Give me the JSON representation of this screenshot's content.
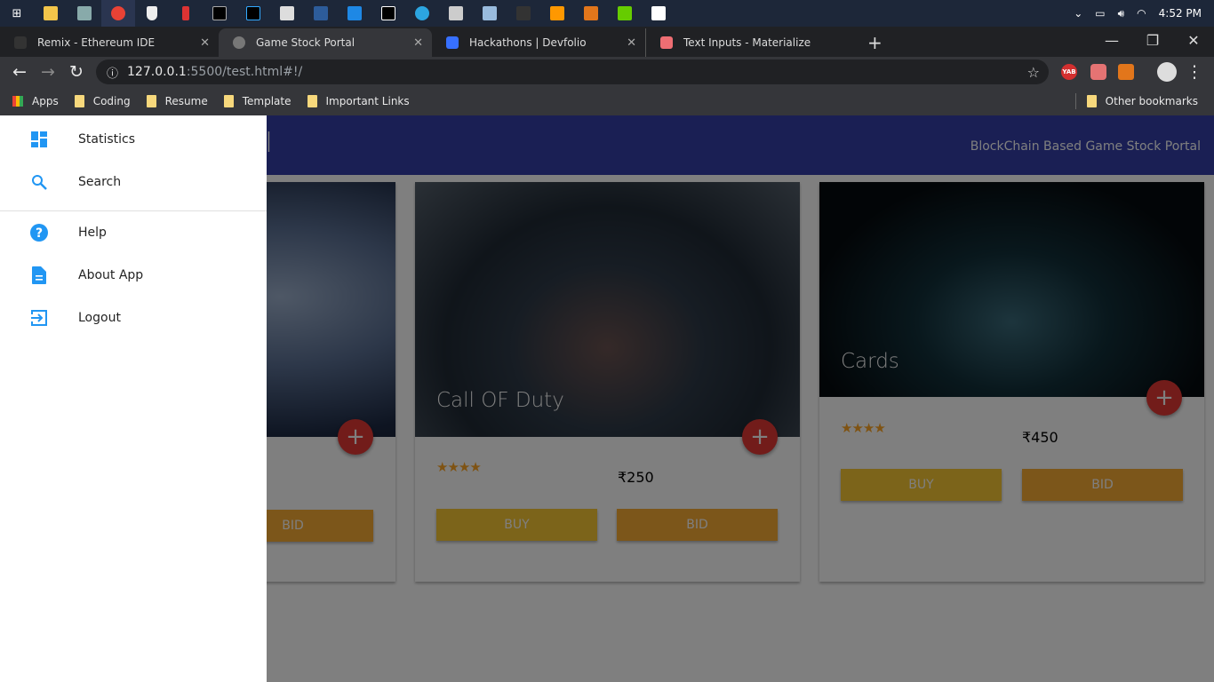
{
  "taskbar": {
    "icons": [
      "windows-start",
      "file-explorer",
      "task-manager",
      "chrome",
      "windows-defender",
      "audio",
      "cmd",
      "intellij",
      "python",
      "mysql-workbench",
      "vscode",
      "webstorm",
      "telegram",
      "app",
      "notepad",
      "terminal",
      "sublime",
      "metamask",
      "camtasia",
      "photos"
    ],
    "time": "4:52 PM"
  },
  "browser": {
    "tabs": [
      {
        "title": "Remix - Ethereum IDE"
      },
      {
        "title": "Game Stock Portal",
        "active": true
      },
      {
        "title": "Hackathons | Devfolio"
      },
      {
        "title": "Text Inputs - Materialize"
      }
    ],
    "url_host": "127.0.0.1",
    "url_path": ":5500/test.html#!/",
    "extensions": {
      "yab": "YAB"
    },
    "bookmarks": [
      "Apps",
      "Coding",
      "Resume",
      "Template",
      "Important Links"
    ],
    "other_bookmarks": "Other bookmarks"
  },
  "header": {
    "brand": "al",
    "right_text": "BlockChain Based Game Stock Portal",
    "color": "#343fa8"
  },
  "cards": [
    {
      "title": "",
      "bid": "BID"
    },
    {
      "title": "Call OF Duty",
      "rating": 4,
      "stars": "★★★★",
      "price": "₹250",
      "buy": "BUY",
      "bid": "BID"
    },
    {
      "title": "Cards",
      "rating": 4,
      "stars": "★★★★",
      "price": "₹450",
      "buy": "BUY",
      "bid": "BID"
    }
  ],
  "sidenav": {
    "items": [
      {
        "label": "Statistics",
        "icon": "dashboard-icon"
      },
      {
        "label": "Search",
        "icon": "search-icon"
      },
      {
        "label": "Help",
        "icon": "help-icon"
      },
      {
        "label": "About App",
        "icon": "description-icon"
      },
      {
        "label": "Logout",
        "icon": "logout-icon"
      }
    ],
    "accent": "#2196f3"
  }
}
